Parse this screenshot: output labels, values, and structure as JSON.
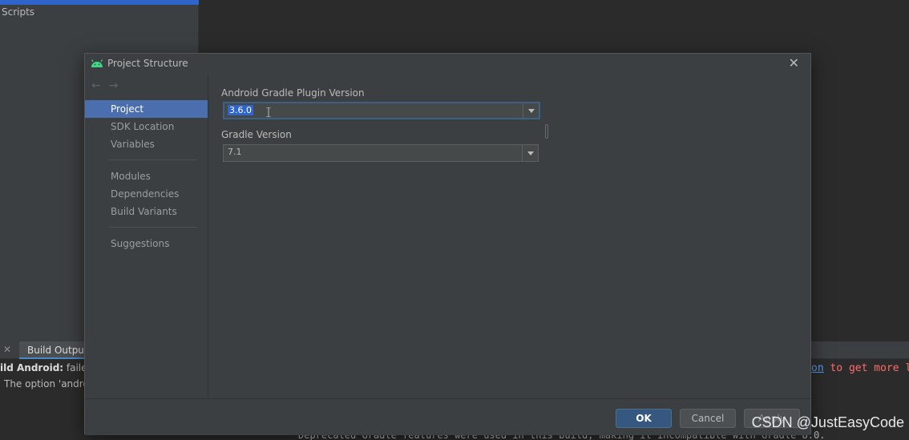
{
  "background": {
    "left_panel_text": "Scripts",
    "build_tab_label": "Build Output",
    "build_line1_bold": "ild Android:",
    "build_line1_rest": " failec",
    "build_line2": "The option 'andro",
    "code_link": "on",
    "code_right_rest": " to get more l",
    "code_bottom": "Deprecated Gradle features were used in this build, making it incompatible with Gradle 8.0."
  },
  "dialog": {
    "title": "Project Structure",
    "sidebar": {
      "items": [
        {
          "label": "Project",
          "selected": true
        },
        {
          "label": "SDK Location"
        },
        {
          "label": "Variables"
        },
        {
          "label": "Modules"
        },
        {
          "label": "Dependencies"
        },
        {
          "label": "Build Variants"
        },
        {
          "label": "Suggestions"
        }
      ]
    },
    "fields": {
      "agp_label": "Android Gradle Plugin Version",
      "agp_value": "3.6.0",
      "gradle_label": "Gradle Version",
      "gradle_value": "7.1"
    },
    "buttons": {
      "ok": "OK",
      "cancel": "Cancel",
      "apply": "Apply"
    }
  },
  "watermark": "CSDN @JustEasyCode",
  "colors": {
    "accent": "#4b6eaf",
    "selection": "#2f65ca",
    "ok_button": "#365880",
    "android_green": "#3ddc84"
  }
}
